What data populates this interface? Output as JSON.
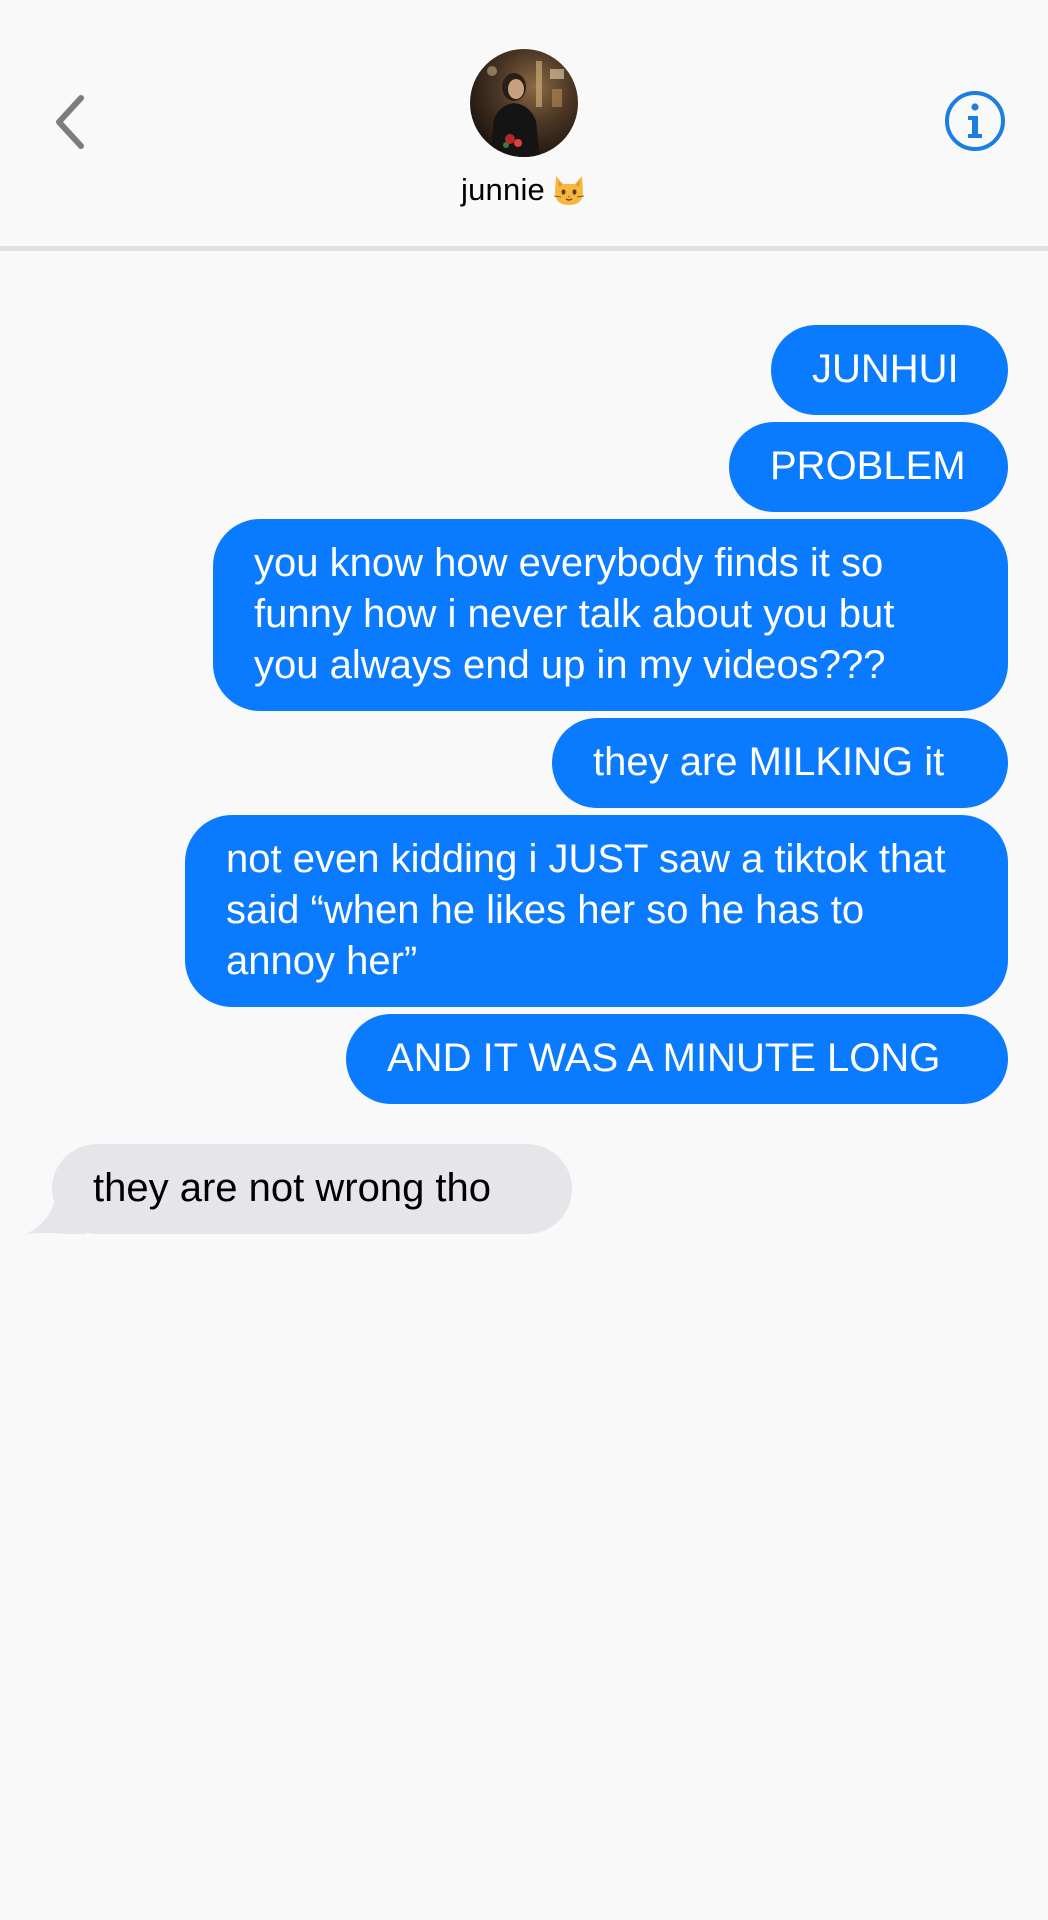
{
  "header": {
    "contact_name": "junnie",
    "name_emoji_icon": "cat-face-icon",
    "back_icon": "chevron-left-icon",
    "info_icon": "info-circle-icon",
    "avatar": "contact-avatar-photo"
  },
  "colors": {
    "sent_bubble": "#0a7aff",
    "received_bubble": "#e6e5ea",
    "accent": "#1a7fe0",
    "background": "#f9f9f9"
  },
  "messages": [
    {
      "direction": "sent",
      "text": "JUNHUI"
    },
    {
      "direction": "sent",
      "text": "PROBLEM"
    },
    {
      "direction": "sent",
      "text": "you know how everybody finds it so funny how i never talk about you but you always end up in my videos???"
    },
    {
      "direction": "sent",
      "text": "they are MILKING it"
    },
    {
      "direction": "sent",
      "text": "not even kidding i JUST saw a tiktok that said “when he likes her so he has to annoy her”"
    },
    {
      "direction": "sent",
      "text": "AND IT WAS A MINUTE LONG"
    },
    {
      "direction": "received",
      "text": "they are not wrong tho"
    }
  ]
}
